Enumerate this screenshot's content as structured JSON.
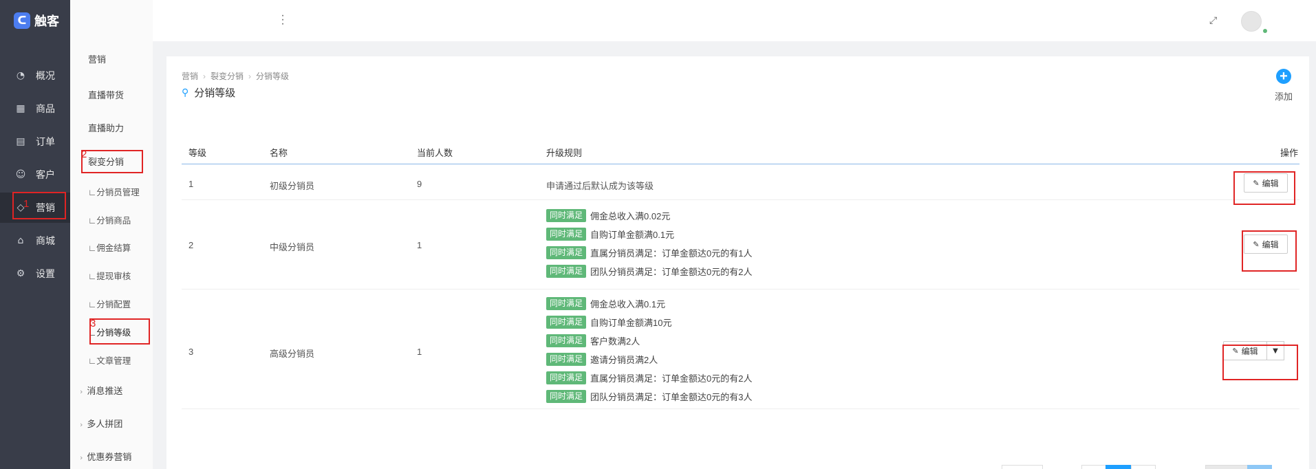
{
  "app": {
    "name": "触客",
    "accent": "#1e9fff",
    "tag_color": "#5fb878",
    "sidebar_bg": "#393d49"
  },
  "nav": [
    {
      "label": "概况",
      "icon": "gauge-icon"
    },
    {
      "label": "商品",
      "icon": "grid-icon"
    },
    {
      "label": "订单",
      "icon": "calendar-icon"
    },
    {
      "label": "客户",
      "icon": "user-icon"
    },
    {
      "label": "营销",
      "icon": "tag-icon",
      "active": true
    },
    {
      "label": "商城",
      "icon": "shop-icon"
    },
    {
      "label": "设置",
      "icon": "gear-icon"
    }
  ],
  "submenu": {
    "header": "营销",
    "items": [
      {
        "label": "直播带货"
      },
      {
        "label": "直播助力"
      },
      {
        "label": "裂变分销"
      },
      {
        "label": "∟分销员管理"
      },
      {
        "label": "∟分销商品"
      },
      {
        "label": "∟佣金结算"
      },
      {
        "label": "∟提现审核"
      },
      {
        "label": "∟分销配置"
      },
      {
        "label": "∟分销等级",
        "active": true
      },
      {
        "label": "∟文章管理"
      },
      {
        "label": "消息推送"
      },
      {
        "label": "多人拼团"
      },
      {
        "label": "优惠券营销"
      }
    ]
  },
  "breadcrumb": [
    "营销",
    "裂变分销",
    "分销等级"
  ],
  "page_title": "分销等级",
  "add_label": "添加",
  "table": {
    "headers": [
      "等级",
      "名称",
      "当前人数",
      "升级规则",
      "操作"
    ],
    "tag_label": "同时满足",
    "edit_label": "编辑",
    "rows": [
      {
        "level": "1",
        "name": "初级分销员",
        "count": "9",
        "plain_rule": "申请通过后默认成为该等级",
        "rules": []
      },
      {
        "level": "2",
        "name": "中级分销员",
        "count": "1",
        "plain_rule": "",
        "rules": [
          "佣金总收入满0.02元",
          "自购订单金额满0.1元",
          "直属分销员满足：订单金额达0元的有1人",
          "团队分销员满足：订单金额达0元的有2人"
        ]
      },
      {
        "level": "3",
        "name": "高级分销员",
        "count": "1",
        "plain_rule": "",
        "rules": [
          "佣金总收入满0.1元",
          "自购订单金额满10元",
          "客户数满2人",
          "邀请分销员满2人",
          "直属分销员满足：订单金额达0元的有2人",
          "团队分销员满足：订单金额达0元的有3人"
        ]
      }
    ]
  },
  "annotations": [
    "1",
    "2",
    "3"
  ]
}
